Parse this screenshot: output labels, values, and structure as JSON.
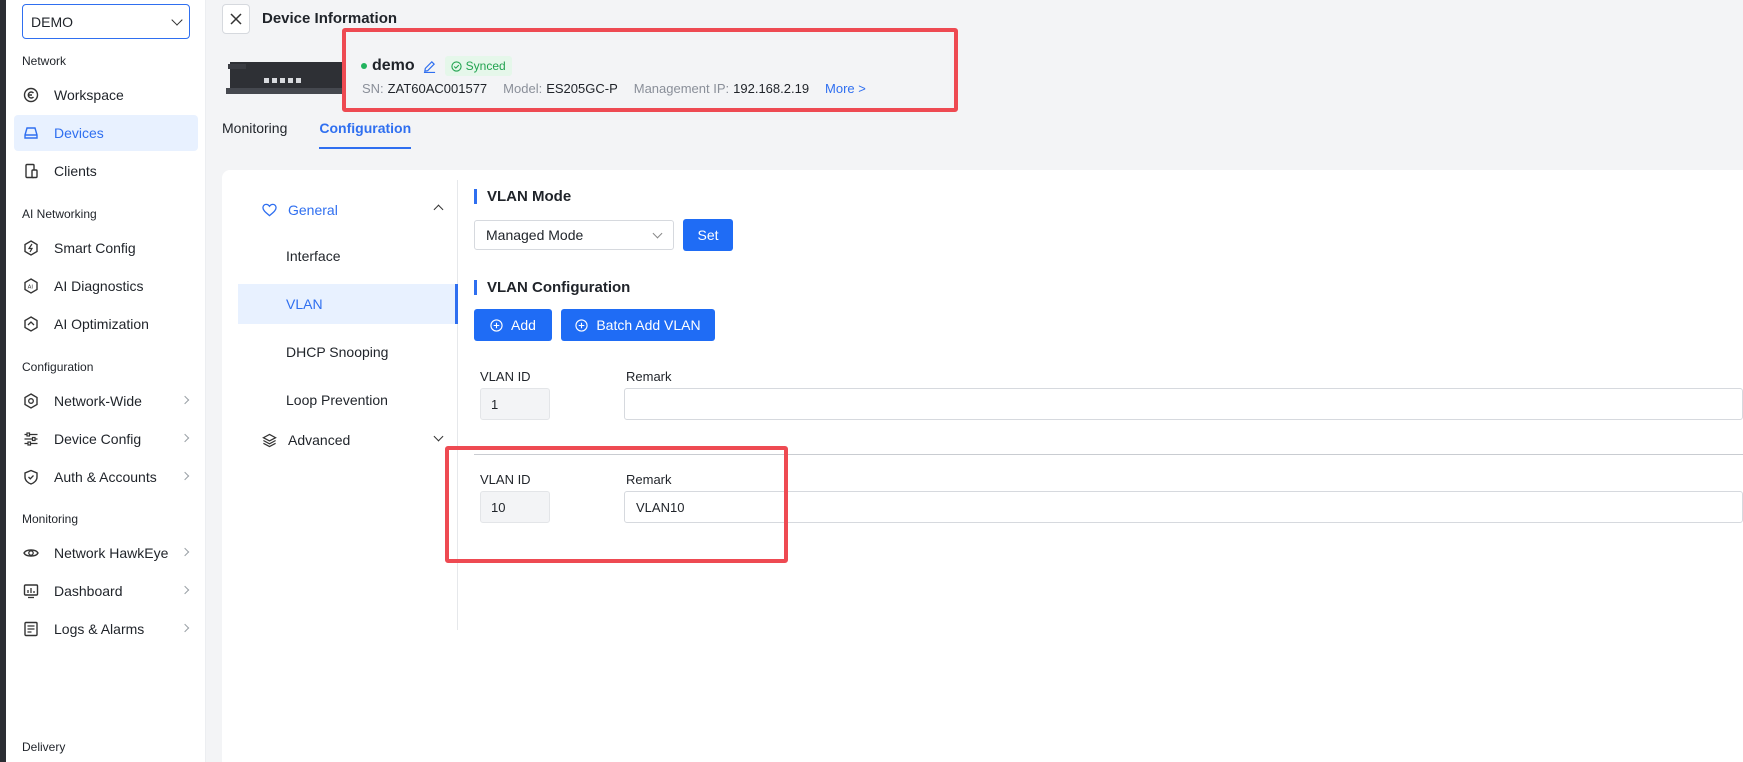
{
  "sidebar": {
    "org_select": "DEMO",
    "sections": {
      "network": "Network",
      "ai_networking": "AI Networking",
      "configuration": "Configuration",
      "monitoring": "Monitoring",
      "delivery": "Delivery"
    },
    "items": {
      "workspace": "Workspace",
      "devices": "Devices",
      "clients": "Clients",
      "smart_config": "Smart Config",
      "ai_diagnostics": "AI Diagnostics",
      "ai_optimization": "AI Optimization",
      "network_wide": "Network-Wide",
      "device_config": "Device Config",
      "auth_accounts": "Auth & Accounts",
      "network_hawkeye": "Network HawkEye",
      "dashboard": "Dashboard",
      "logs_alarms": "Logs & Alarms"
    }
  },
  "header": {
    "title": "Device Information"
  },
  "device": {
    "name": "demo",
    "status_badge": "Synced",
    "sn_label": "SN:",
    "sn": "ZAT60AC001577",
    "model_label": "Model:",
    "model": "ES205GC-P",
    "ip_label": "Management IP:",
    "ip": "192.168.2.19",
    "more": "More >"
  },
  "tabs": {
    "monitoring": "Monitoring",
    "configuration": "Configuration"
  },
  "subnav": {
    "general": "General",
    "interface": "Interface",
    "vlan": "VLAN",
    "dhcp_snooping": "DHCP Snooping",
    "loop_prevention": "Loop Prevention",
    "advanced": "Advanced"
  },
  "vlan_mode": {
    "title": "VLAN Mode",
    "selected": "Managed Mode",
    "set_button": "Set"
  },
  "vlan_config": {
    "title": "VLAN Configuration",
    "add_button": "Add",
    "batch_add_button": "Batch Add VLAN",
    "id_label": "VLAN ID",
    "remark_label": "Remark",
    "rows": [
      {
        "id": "1",
        "remark": ""
      },
      {
        "id": "10",
        "remark": "VLAN10"
      }
    ]
  },
  "colors": {
    "accent": "#2f6ff0",
    "highlight": "#ee4a52",
    "success": "#22b35e"
  }
}
